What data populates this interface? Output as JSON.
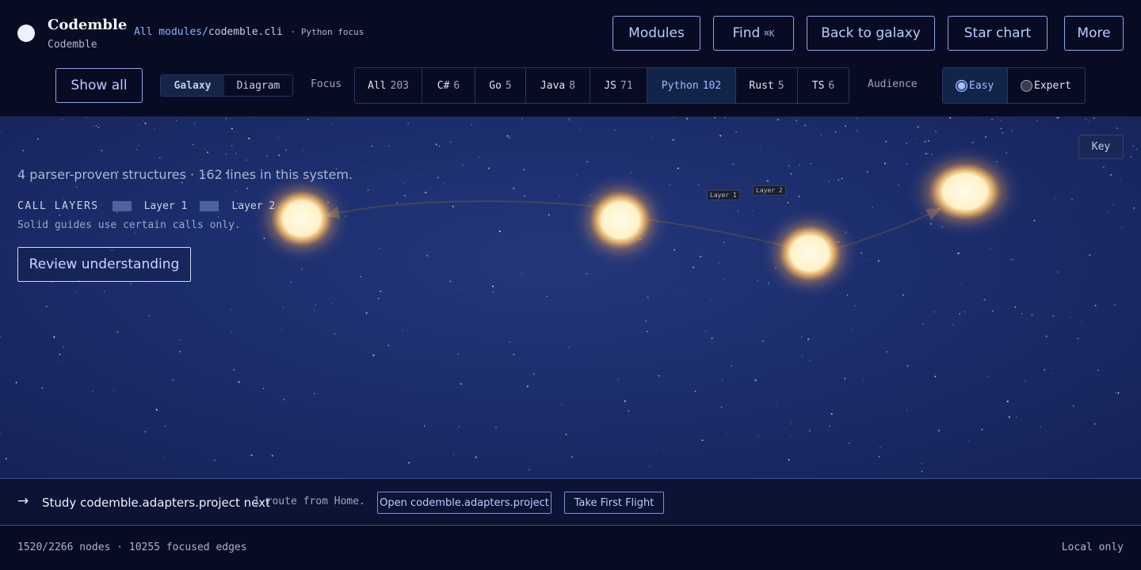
{
  "app": {
    "title": "Codemble",
    "subtitle": "Codemble"
  },
  "breadcrumb": {
    "root": "All modules",
    "separator": "/",
    "current": "codemble.cli",
    "focus_note": "· Python focus"
  },
  "nav": {
    "modules": "Modules",
    "find": "Find",
    "find_shortcut": "⌘K",
    "back": "Back to galaxy",
    "star_chart": "Star chart",
    "more": "More"
  },
  "controls": {
    "show_all": "Show all",
    "views": [
      "Galaxy",
      "Diagram"
    ],
    "active_view": "Galaxy",
    "focus_label": "Focus",
    "languages": [
      {
        "name": "All",
        "count": "203"
      },
      {
        "name": "C#",
        "count": "6"
      },
      {
        "name": "Go",
        "count": "5"
      },
      {
        "name": "Java",
        "count": "8"
      },
      {
        "name": "JS",
        "count": "71"
      },
      {
        "name": "Python",
        "count": "102"
      },
      {
        "name": "Rust",
        "count": "5"
      },
      {
        "name": "TS",
        "count": "6"
      }
    ],
    "active_language": "Python",
    "audience_label": "Audience",
    "audience": [
      "Easy",
      "Expert"
    ],
    "active_audience": "Easy"
  },
  "galaxy": {
    "summary": "4 parser-proven structures · 162 lines in this system.",
    "call_layers_title": "CALL LAYERS",
    "layers": [
      "Layer 1",
      "Layer 2"
    ],
    "guides_note": "Solid guides use certain calls only.",
    "review_button": "Review understanding",
    "key_button": "Key",
    "edge_tags": [
      "Layer 1",
      "Layer 2"
    ],
    "star_count": 4,
    "colors": {
      "star_core": "#fff6d8",
      "star_glow": "#ffb347",
      "edge": "#4a4a52"
    }
  },
  "next_step": {
    "arrow": "→",
    "title": "Study codemble.adapters.project next",
    "route": "1 route from Home.",
    "open_button": "Open codemble.adapters.project",
    "flight_button": "Take First Flight"
  },
  "status": {
    "nodes": "1520/2266 nodes · 10255 focused edges",
    "mode": "Local only"
  }
}
